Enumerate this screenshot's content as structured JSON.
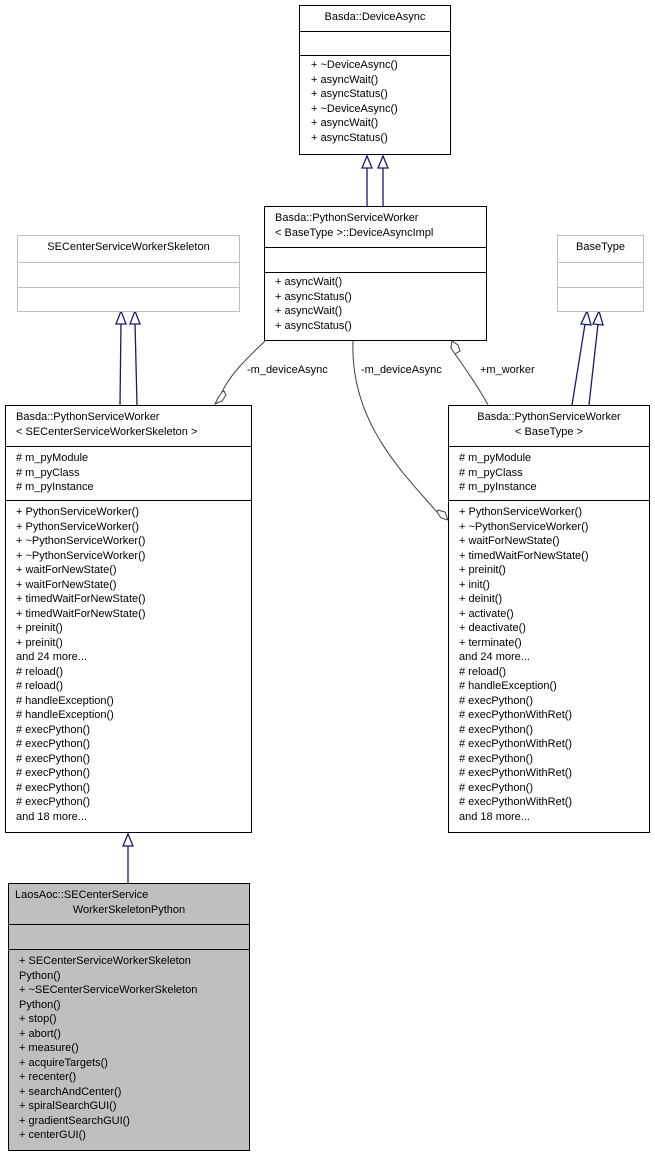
{
  "diagram": {
    "classes": {
      "device_async": {
        "name": "Basda::DeviceAsync",
        "attributes": [],
        "methods": [
          "+ ~DeviceAsync()",
          "+ asyncWait()",
          "+ asyncStatus()",
          "+ ~DeviceAsync()",
          "+ asyncWait()",
          "+ asyncStatus()"
        ]
      },
      "device_async_impl": {
        "name_line1": "Basda::PythonServiceWorker",
        "name_line2": "< BaseType >::DeviceAsyncImpl",
        "attributes": [],
        "methods": [
          "+ asyncWait()",
          "+ asyncStatus()",
          "+ asyncWait()",
          "+ asyncStatus()"
        ]
      },
      "skeleton": {
        "name": "SECenterServiceWorkerSkeleton",
        "attributes": [],
        "methods": []
      },
      "base_type": {
        "name": "BaseType",
        "attributes": [],
        "methods": []
      },
      "psw_skeleton": {
        "name_line1": "Basda::PythonServiceWorker",
        "name_line2": "< SECenterServiceWorkerSkeleton >",
        "attributes": [
          "# m_pyModule",
          "# m_pyClass",
          "# m_pyInstance"
        ],
        "methods": [
          "+ PythonServiceWorker()",
          "+ PythonServiceWorker()",
          "+ ~PythonServiceWorker()",
          "+ ~PythonServiceWorker()",
          "+ waitForNewState()",
          "+ waitForNewState()",
          "+ timedWaitForNewState()",
          "+ timedWaitForNewState()",
          "+ preinit()",
          "+ preinit()",
          "and 24 more...",
          "# reload()",
          "# reload()",
          "# handleException()",
          "# handleException()",
          "# execPython()",
          "# execPython()",
          "# execPython()",
          "# execPython()",
          "# execPython()",
          "# execPython()",
          "and 18 more..."
        ]
      },
      "psw_basetype": {
        "name_line1": "Basda::PythonServiceWorker",
        "name_line2": "< BaseType >",
        "attributes": [
          "# m_pyModule",
          "# m_pyClass",
          "# m_pyInstance"
        ],
        "methods": [
          "+ PythonServiceWorker()",
          "+ ~PythonServiceWorker()",
          "+ waitForNewState()",
          "+ timedWaitForNewState()",
          "+ preinit()",
          "+ init()",
          "+ deinit()",
          "+ activate()",
          "+ deactivate()",
          "+ terminate()",
          "and 24 more...",
          "# reload()",
          "# handleException()",
          "# execPython()",
          "# execPythonWithRet()",
          "# execPython()",
          "# execPythonWithRet()",
          "# execPython()",
          "# execPythonWithRet()",
          "# execPython()",
          "# execPythonWithRet()",
          "and 18 more..."
        ]
      },
      "focus": {
        "name_line1": "LaosAoc::SECenterService",
        "name_line2": "WorkerSkeletonPython",
        "attributes": [],
        "methods": [
          "+ SECenterServiceWorkerSkeleton",
          "Python()",
          "+ ~SECenterServiceWorkerSkeleton",
          "Python()",
          "+ stop()",
          "+ abort()",
          "+ measure()",
          "+ acquireTargets()",
          "+ recenter()",
          "+ searchAndCenter()",
          "+ spiralSearchGUI()",
          "+ gradientSearchGUI()",
          "+ centerGUI()"
        ]
      }
    },
    "edge_labels": {
      "left_device_async": "-m_deviceAsync",
      "right_device_async": "-m_deviceAsync",
      "worker": "+m_worker"
    },
    "colors": {
      "inheritance": "#191970",
      "association": "#404040",
      "focus_fill": "#bfbfbf",
      "external_border": "#bfbfbf"
    }
  }
}
